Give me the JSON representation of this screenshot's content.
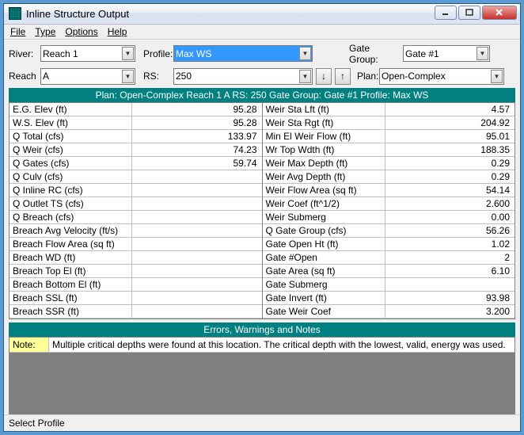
{
  "window": {
    "title": "Inline Structure Output"
  },
  "menu": {
    "file": "File",
    "type": "Type",
    "options": "Options",
    "help": "Help"
  },
  "controls": {
    "river_lbl": "River:",
    "river": "Reach 1",
    "profile_lbl": "Profile:",
    "profile": "Max WS",
    "gategroup_lbl": "Gate Group:",
    "gategroup": "Gate #1",
    "reach_lbl": "Reach",
    "reach": "A",
    "rs_lbl": "RS:",
    "rs": "250",
    "plan_lbl": "Plan:",
    "plan": "Open-Complex"
  },
  "banner": "Plan: Open-Complex    Reach 1    A  RS: 250  Gate Group:  Gate #1  Profile: Max WS",
  "left_rows": [
    {
      "l": "E.G. Elev (ft)",
      "v": "95.28"
    },
    {
      "l": "W.S. Elev (ft)",
      "v": "95.28"
    },
    {
      "l": "Q Total (cfs)",
      "v": "133.97"
    },
    {
      "l": "Q Weir (cfs)",
      "v": "74.23"
    },
    {
      "l": "Q Gates (cfs)",
      "v": "59.74"
    },
    {
      "l": "Q Culv (cfs)",
      "v": ""
    },
    {
      "l": "Q Inline RC (cfs)",
      "v": ""
    },
    {
      "l": "Q Outlet TS (cfs)",
      "v": ""
    },
    {
      "l": "Q Breach (cfs)",
      "v": ""
    },
    {
      "l": "Breach Avg Velocity (ft/s)",
      "v": ""
    },
    {
      "l": "Breach Flow Area (sq ft)",
      "v": ""
    },
    {
      "l": "Breach WD (ft)",
      "v": ""
    },
    {
      "l": "Breach Top El (ft)",
      "v": ""
    },
    {
      "l": "Breach Bottom El (ft)",
      "v": ""
    },
    {
      "l": "Breach SSL (ft)",
      "v": ""
    },
    {
      "l": "Breach SSR (ft)",
      "v": ""
    }
  ],
  "right_rows": [
    {
      "l": "Weir Sta Lft (ft)",
      "v": "4.57"
    },
    {
      "l": "Weir Sta Rgt (ft)",
      "v": "204.92"
    },
    {
      "l": "Min El Weir Flow (ft)",
      "v": "95.01"
    },
    {
      "l": "Wr Top Wdth (ft)",
      "v": "188.35"
    },
    {
      "l": "Weir Max Depth (ft)",
      "v": "0.29"
    },
    {
      "l": "Weir Avg Depth (ft)",
      "v": "0.29"
    },
    {
      "l": "Weir Flow Area (sq ft)",
      "v": "54.14"
    },
    {
      "l": "Weir Coef (ft^1/2)",
      "v": "2.600"
    },
    {
      "l": "Weir Submerg",
      "v": "0.00"
    },
    {
      "l": "Q Gate Group (cfs)",
      "v": "56.26"
    },
    {
      "l": "Gate Open Ht (ft)",
      "v": "1.02"
    },
    {
      "l": "Gate #Open",
      "v": "2"
    },
    {
      "l": "Gate Area (sq ft)",
      "v": "6.10"
    },
    {
      "l": "Gate Submerg",
      "v": ""
    },
    {
      "l": "Gate Invert (ft)",
      "v": "93.98"
    },
    {
      "l": "Gate Weir Coef",
      "v": "3.200"
    }
  ],
  "notes": {
    "header": "Errors, Warnings and Notes",
    "key": "Note:",
    "text": "Multiple critical depths were found at this location.  The critical depth with the lowest, valid, energy was used."
  },
  "status": "Select Profile"
}
